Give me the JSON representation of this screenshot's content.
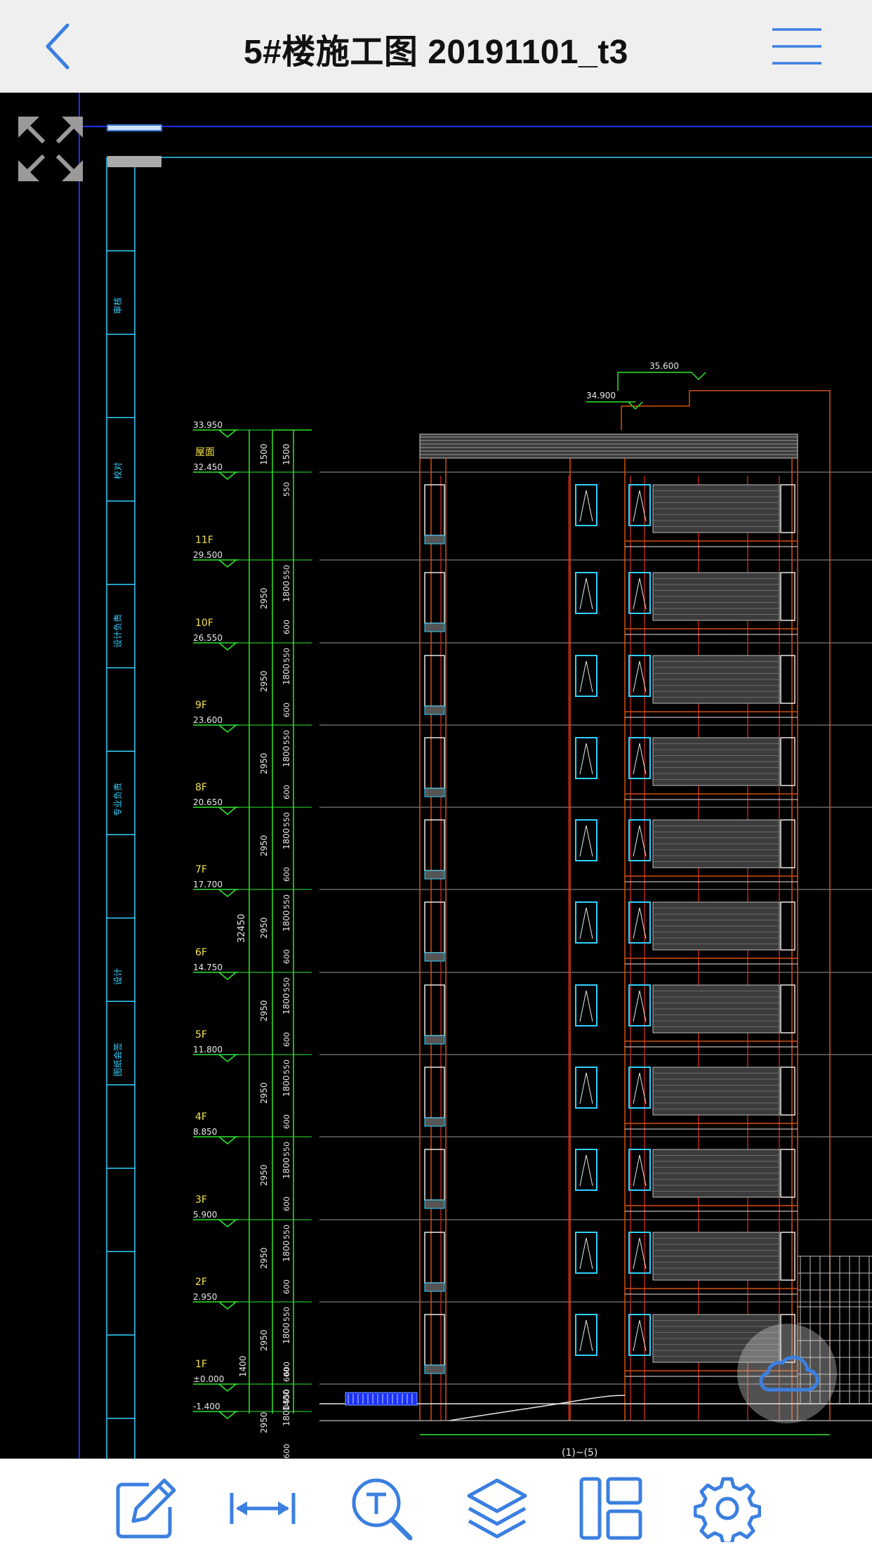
{
  "header": {
    "title": "5#楼施工图 20191101_t3"
  },
  "icons": {
    "back": "chevron-left-icon",
    "menu": "hamburger-menu-icon",
    "fullscreen": "expand-arrows-icon",
    "cloud": "cloud-icon"
  },
  "colors": {
    "accent": "#3b7fe0",
    "canvas": "#000000",
    "green": "#2ee82e",
    "orange": "#d4500a",
    "red": "#e03020",
    "cyan": "#33d0ff",
    "blue": "#1a32ff"
  },
  "drawing": {
    "floors": [
      {
        "label": "",
        "elev": "33.950"
      },
      {
        "label": "屋面",
        "elev": "32.450"
      },
      {
        "label": "11F",
        "elev": "29.500"
      },
      {
        "label": "10F",
        "elev": "26.550"
      },
      {
        "label": "9F",
        "elev": "23.600"
      },
      {
        "label": "8F",
        "elev": "20.650"
      },
      {
        "label": "7F",
        "elev": "17.700"
      },
      {
        "label": "6F",
        "elev": "14.750"
      },
      {
        "label": "5F",
        "elev": "11.800"
      },
      {
        "label": "4F",
        "elev": "8.850"
      },
      {
        "label": "3F",
        "elev": "5.900"
      },
      {
        "label": "2F",
        "elev": "2.950"
      },
      {
        "label": "1F",
        "elev": "±0.000"
      },
      {
        "label": "",
        "elev": "-1.400"
      }
    ],
    "top_elevations": [
      "35.600",
      "34.900"
    ],
    "story_dim": "2950",
    "total_dim": "32450",
    "roof_dims": [
      "1500",
      "1500",
      "550"
    ],
    "segment_dims": [
      "1800",
      "600",
      "550"
    ],
    "base_dims": [
      "1400",
      "1400",
      "600"
    ],
    "title_block_labels": [
      "审核",
      "校对",
      "设计负责",
      "专业负责",
      "设计",
      "图纸会签"
    ],
    "bottom_label": "(1)~(5)"
  },
  "toolbar": {
    "items": [
      {
        "name": "markup-tool",
        "icon": "pencil-edit-icon"
      },
      {
        "name": "measure-tool",
        "icon": "measure-arrows-icon"
      },
      {
        "name": "text-search-tool",
        "icon": "text-search-icon"
      },
      {
        "name": "layers-tool",
        "icon": "layers-icon"
      },
      {
        "name": "layout-tool",
        "icon": "layout-panels-icon"
      },
      {
        "name": "settings-tool",
        "icon": "gear-icon"
      }
    ]
  }
}
